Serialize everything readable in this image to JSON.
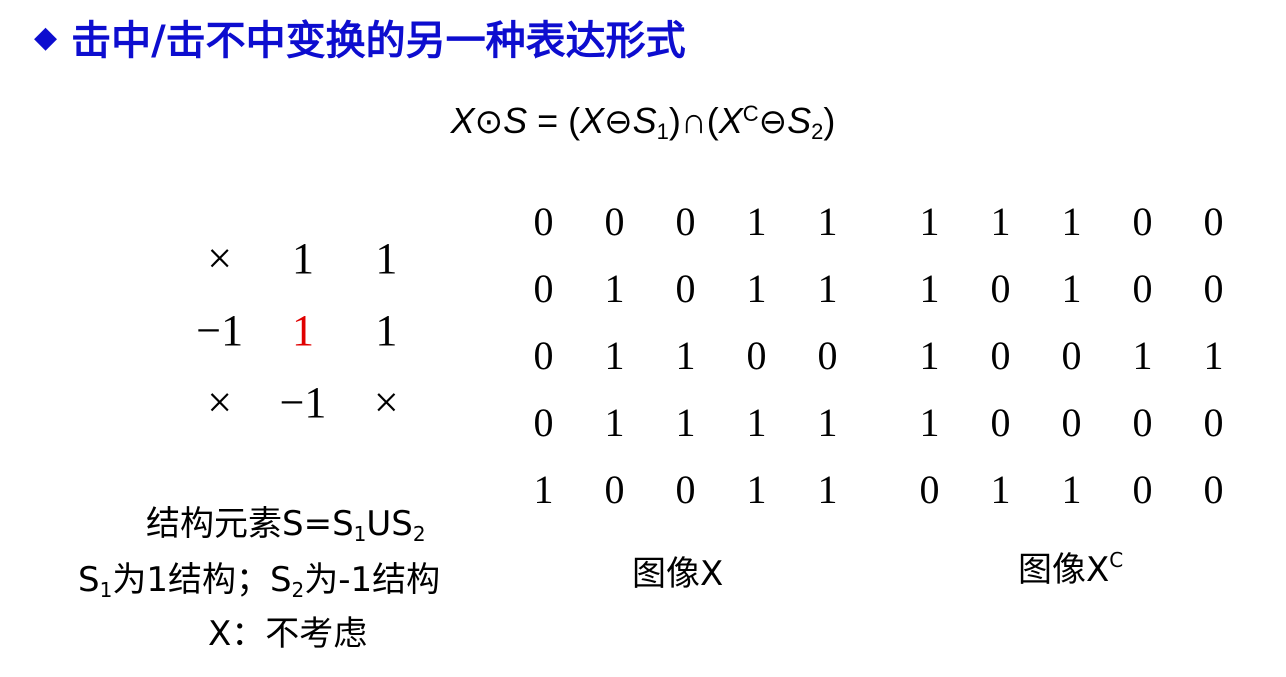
{
  "slide": {
    "bullet": "◆",
    "title": "击中/击不中变换的另一种表达形式",
    "formula": {
      "X": "X",
      "odot": "⊙",
      "S": "S",
      "eq": " = (",
      "ominus": "⊖",
      "s_sub1": "1",
      "close_cap": ")∩(",
      "c_sup": "C",
      "s_sub2": "2",
      "close": ")"
    },
    "structuring_element": [
      [
        "×",
        "1",
        "1"
      ],
      [
        "−1",
        "1",
        "1"
      ],
      [
        "×",
        "−1",
        "×"
      ]
    ],
    "se_center_color": "#e00000",
    "image_x": [
      [
        "0",
        "0",
        "0",
        "1",
        "1"
      ],
      [
        "0",
        "1",
        "0",
        "1",
        "1"
      ],
      [
        "0",
        "1",
        "1",
        "0",
        "0"
      ],
      [
        "0",
        "1",
        "1",
        "1",
        "1"
      ],
      [
        "1",
        "0",
        "0",
        "1",
        "1"
      ]
    ],
    "image_xc": [
      [
        "1",
        "1",
        "1",
        "0",
        "0"
      ],
      [
        "1",
        "0",
        "1",
        "0",
        "0"
      ],
      [
        "1",
        "0",
        "0",
        "1",
        "1"
      ],
      [
        "1",
        "0",
        "0",
        "0",
        "0"
      ],
      [
        "0",
        "1",
        "1",
        "0",
        "0"
      ]
    ],
    "captions": {
      "se_line1_a": "结构元素S=S",
      "se_line1_sub1": "1",
      "se_line1_b": "US",
      "se_line1_sub2": "2",
      "se_line2_a": "S",
      "se_line2_sub1": "1",
      "se_line2_b": "为1结构；S",
      "se_line2_sub2": "2",
      "se_line2_c": "为-1结构",
      "se_line3": "X：不考虑",
      "image_x_label": "图像X",
      "image_xc_label": "图像X",
      "image_xc_sup": "C"
    },
    "title_color": "#0d0dcf"
  }
}
